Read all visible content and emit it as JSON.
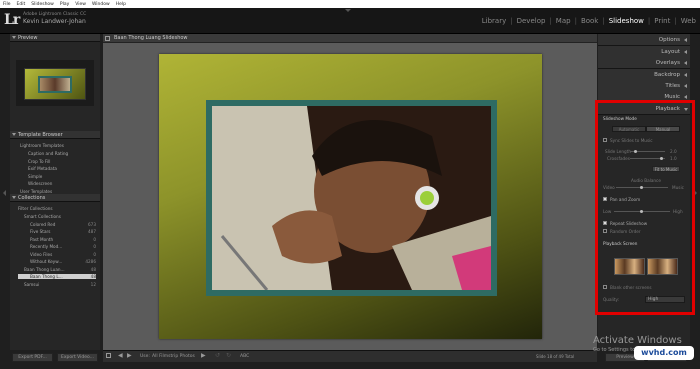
{
  "menubar": {
    "items": [
      "File",
      "Edit",
      "Slideshow",
      "Play",
      "View",
      "Window",
      "Help"
    ]
  },
  "identity": {
    "logo": "Lr",
    "catalog": "Adobe Lightroom Classic CC",
    "user": "Kevin Landwer-Johan"
  },
  "modules": {
    "items": [
      "Library",
      "Develop",
      "Map",
      "Book",
      "Slideshow",
      "Print",
      "Web"
    ],
    "active": "Slideshow"
  },
  "left_panel": {
    "preview_label": "Preview",
    "template_browser_label": "Template Browser",
    "templates": [
      "Lightroom Templates",
      "Caption and Rating",
      "Crop To Fill",
      "Exif Metadata",
      "Simple",
      "Widescreen",
      "User Templates"
    ],
    "collections_label": "Collections",
    "collections": [
      {
        "name": "Filter Collections",
        "count": ""
      },
      {
        "name": "Smart Collections",
        "count": ""
      },
      {
        "name": "Colored Red",
        "count": "673"
      },
      {
        "name": "Five Stars",
        "count": "487"
      },
      {
        "name": "Past Month",
        "count": "0"
      },
      {
        "name": "Recently Mod...",
        "count": "0"
      },
      {
        "name": "Video Files",
        "count": "0"
      },
      {
        "name": "Without Keyw...",
        "count": "4286"
      },
      {
        "name": "Baan Thong Luan...",
        "count": "48"
      },
      {
        "name": "Baan Thong L...",
        "count": "48"
      },
      {
        "name": "Samsui",
        "count": "12"
      }
    ],
    "export_pdf": "Export PDF...",
    "export_video": "Export Video..."
  },
  "center": {
    "title": "Baan Thong Luang Slideshow",
    "toolbar": {
      "use_label": "Use:",
      "use_value": "All Filmstrip Photos",
      "abc": "ABC",
      "counter": "Slide 18 of 49 Total"
    }
  },
  "right_panel": {
    "sections": [
      "Options",
      "Layout",
      "Overlays",
      "Backdrop",
      "Titles",
      "Music",
      "Playback"
    ],
    "slideshow_mode_label": "Slideshow Mode",
    "mode_automatic": "Automatic",
    "mode_manual": "Manual",
    "sync_music": "Sync Slides to Music",
    "slide_length_label": "Slide Length",
    "slide_length_value": "2.0",
    "crossfades_label": "Crossfades",
    "crossfades_value": "1.0",
    "fit_to_music": "Fit to Music",
    "audio_balance_label": "Audio Balance",
    "audio_video": "Video",
    "audio_music": "Music",
    "pan_zoom": "Pan and Zoom",
    "pan_low": "Low",
    "pan_high": "High",
    "repeat": "Repeat Slideshow",
    "random": "Random Order",
    "playback_screen": "Playback Screen",
    "blank_screens": "Blank other screens",
    "quality_label": "Quality:",
    "quality_value": "High",
    "preview_btn": "Preview",
    "play_btn": "Play"
  },
  "watermark": {
    "line1": "Activate Windows",
    "line2": "Go to Settings to activate Windows.",
    "logo": "wvhd.com"
  },
  "colors": {
    "highlight": "#e10000",
    "frame": "#2e6b63",
    "backdrop_top": "#b0b436",
    "backdrop_bottom": "#22250a"
  }
}
